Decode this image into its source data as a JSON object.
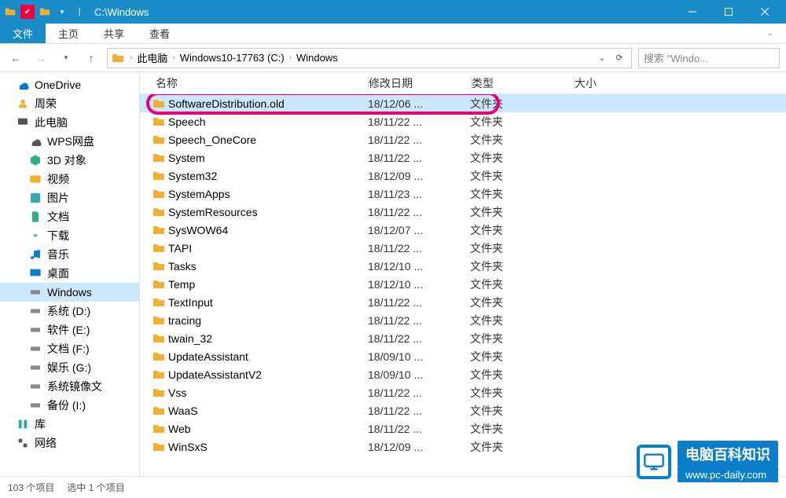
{
  "title": "C:\\Windows",
  "ribbon": {
    "file": "文件",
    "home": "主页",
    "share": "共享",
    "view": "查看"
  },
  "breadcrumb": {
    "items": [
      "此电脑",
      "Windows10-17763 (C:)",
      "Windows"
    ]
  },
  "search": {
    "placeholder": "搜索 \"Windo..."
  },
  "tree": [
    {
      "label": "OneDrive",
      "icon": "cloud",
      "color": "#0078d4",
      "lvl": 1
    },
    {
      "label": "周荣",
      "icon": "user",
      "color": "#f0b030",
      "lvl": 1
    },
    {
      "label": "此电脑",
      "icon": "pc",
      "color": "#555",
      "lvl": 1
    },
    {
      "label": "WPS网盘",
      "icon": "cloud",
      "color": "#555",
      "lvl": 2
    },
    {
      "label": "3D 对象",
      "icon": "cube",
      "color": "#3a8",
      "lvl": 2
    },
    {
      "label": "视频",
      "icon": "video",
      "color": "#f0b030",
      "lvl": 2
    },
    {
      "label": "图片",
      "icon": "image",
      "color": "#3aa",
      "lvl": 2
    },
    {
      "label": "文档",
      "icon": "doc",
      "color": "#3a8",
      "lvl": 2
    },
    {
      "label": "下载",
      "icon": "download",
      "color": "#3a8",
      "lvl": 2
    },
    {
      "label": "音乐",
      "icon": "music",
      "color": "#0a7ec9",
      "lvl": 2
    },
    {
      "label": "桌面",
      "icon": "desktop",
      "color": "#0a7ec9",
      "lvl": 2
    },
    {
      "label": "Windows",
      "icon": "disk",
      "color": "#888",
      "lvl": 2,
      "selected": true
    },
    {
      "label": "系统 (D:)",
      "icon": "disk",
      "color": "#888",
      "lvl": 2
    },
    {
      "label": "软件 (E:)",
      "icon": "disk",
      "color": "#888",
      "lvl": 2
    },
    {
      "label": "文档 (F:)",
      "icon": "disk",
      "color": "#888",
      "lvl": 2
    },
    {
      "label": "娱乐 (G:)",
      "icon": "disk",
      "color": "#888",
      "lvl": 2
    },
    {
      "label": "系统镜像文",
      "icon": "disk",
      "color": "#888",
      "lvl": 2
    },
    {
      "label": "备份 (I:)",
      "icon": "disk",
      "color": "#888",
      "lvl": 2
    },
    {
      "label": "库",
      "icon": "lib",
      "color": "#3aa",
      "lvl": 1
    },
    {
      "label": "网络",
      "icon": "net",
      "color": "#555",
      "lvl": 1
    }
  ],
  "columns": {
    "name": "名称",
    "date": "修改日期",
    "type": "类型",
    "size": "大小"
  },
  "files": [
    {
      "name": "SoftwareDistribution.old",
      "date": "18/12/06 ...",
      "type": "文件夹",
      "selected": true,
      "highlighted": true
    },
    {
      "name": "Speech",
      "date": "18/11/22 ...",
      "type": "文件夹"
    },
    {
      "name": "Speech_OneCore",
      "date": "18/11/22 ...",
      "type": "文件夹"
    },
    {
      "name": "System",
      "date": "18/11/22 ...",
      "type": "文件夹"
    },
    {
      "name": "System32",
      "date": "18/12/09 ...",
      "type": "文件夹"
    },
    {
      "name": "SystemApps",
      "date": "18/11/23 ...",
      "type": "文件夹"
    },
    {
      "name": "SystemResources",
      "date": "18/11/22 ...",
      "type": "文件夹"
    },
    {
      "name": "SysWOW64",
      "date": "18/12/07 ...",
      "type": "文件夹"
    },
    {
      "name": "TAPI",
      "date": "18/11/22 ...",
      "type": "文件夹"
    },
    {
      "name": "Tasks",
      "date": "18/12/10 ...",
      "type": "文件夹"
    },
    {
      "name": "Temp",
      "date": "18/12/10 ...",
      "type": "文件夹"
    },
    {
      "name": "TextInput",
      "date": "18/11/22 ...",
      "type": "文件夹"
    },
    {
      "name": "tracing",
      "date": "18/11/22 ...",
      "type": "文件夹"
    },
    {
      "name": "twain_32",
      "date": "18/11/22 ...",
      "type": "文件夹"
    },
    {
      "name": "UpdateAssistant",
      "date": "18/09/10 ...",
      "type": "文件夹"
    },
    {
      "name": "UpdateAssistantV2",
      "date": "18/09/10 ...",
      "type": "文件夹"
    },
    {
      "name": "Vss",
      "date": "18/11/22 ...",
      "type": "文件夹"
    },
    {
      "name": "WaaS",
      "date": "18/11/22 ...",
      "type": "文件夹"
    },
    {
      "name": "Web",
      "date": "18/11/22 ...",
      "type": "文件夹"
    },
    {
      "name": "WinSxS",
      "date": "18/12/09 ...",
      "type": "文件夹"
    }
  ],
  "status": {
    "count": "103 个项目",
    "selected": "选中 1 个项目"
  },
  "watermark": {
    "brand": "电脑百科知识",
    "url": "www.pc-daily.com"
  }
}
